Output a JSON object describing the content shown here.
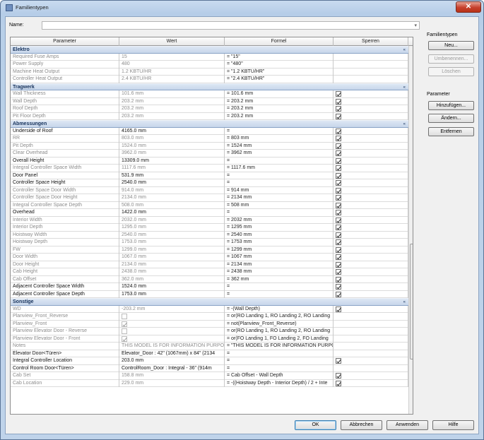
{
  "window": {
    "title": "Familientypen",
    "close_glyph": "✕"
  },
  "name_field": {
    "label": "Name:",
    "value": ""
  },
  "grid": {
    "headers": [
      "Parameter",
      "Wert",
      "Formel",
      "Sperren"
    ],
    "groups": [
      {
        "label": "Elektro",
        "toggle": "«",
        "rows": [
          {
            "p": "Required Fuse Amps",
            "w": "15",
            "f": "= \"15\"",
            "lock": null,
            "style": "gray"
          },
          {
            "p": "Power Supply",
            "w": "480",
            "f": "= \"480\"",
            "lock": null,
            "style": "gray"
          },
          {
            "p": "Machine Heat Output",
            "w": "1.2 KBTU/HR",
            "f": "= \"1.2 KBTU/HR\"",
            "lock": null,
            "style": "gray"
          },
          {
            "p": "Controller Heat Output",
            "w": "2.4 KBTU/HR",
            "f": "= \"2.4 KBTU/HR\"",
            "lock": null,
            "style": "gray"
          }
        ]
      },
      {
        "label": "Tragwerk",
        "toggle": "«",
        "rows": [
          {
            "p": "Wall Thickness",
            "w": "101.6 mm",
            "f": "= 101.6 mm",
            "lock": "on",
            "style": "gray"
          },
          {
            "p": "Wall Depth",
            "w": "203.2 mm",
            "f": "= 203.2 mm",
            "lock": "on",
            "style": "gray"
          },
          {
            "p": "Roof Depth",
            "w": "203.2 mm",
            "f": "= 203.2 mm",
            "lock": "on",
            "style": "gray"
          },
          {
            "p": "Pit Floor Depth",
            "w": "203.2 mm",
            "f": "= 203.2 mm",
            "lock": "on",
            "style": "gray"
          }
        ]
      },
      {
        "label": "Abmessungen",
        "toggle": "«",
        "rows": [
          {
            "p": "Underside of Roof",
            "w": "4165.0 mm",
            "f": "=",
            "lock": "on",
            "style": "dark"
          },
          {
            "p": "RR",
            "w": "803.0 mm",
            "f": "= 803 mm",
            "lock": "on",
            "style": "gray"
          },
          {
            "p": "Pit Depth",
            "w": "1524.0 mm",
            "f": "= 1524 mm",
            "lock": "on",
            "style": "gray"
          },
          {
            "p": "Clear Overhead",
            "w": "3962.0 mm",
            "f": "= 3962 mm",
            "lock": "on",
            "style": "gray"
          },
          {
            "p": "Overall Height",
            "w": "13309.0 mm",
            "f": "=",
            "lock": "on",
            "style": "dark"
          },
          {
            "p": "Integral Controller Space Width",
            "w": "1117.6 mm",
            "f": "= 1117.6 mm",
            "lock": "on",
            "style": "gray"
          },
          {
            "p": "Door Panel",
            "w": "531.9 mm",
            "f": "=",
            "lock": "on",
            "style": "dark"
          },
          {
            "p": "Controller Space Height",
            "w": "2540.0 mm",
            "f": "=",
            "lock": "on",
            "style": "dark"
          },
          {
            "p": "Controller Space Door Width",
            "w": "914.0 mm",
            "f": "= 914 mm",
            "lock": "on",
            "style": "gray"
          },
          {
            "p": "Controller Space Door Height",
            "w": "2134.0 mm",
            "f": "= 2134 mm",
            "lock": "on",
            "style": "gray"
          },
          {
            "p": "Integral Controller Space Depth",
            "w": "508.0 mm",
            "f": "= 508 mm",
            "lock": "on",
            "style": "gray"
          },
          {
            "p": "Overhead",
            "w": "1422.0 mm",
            "f": "=",
            "lock": "on",
            "style": "dark"
          },
          {
            "p": "Interior Width",
            "w": "2032.0 mm",
            "f": "= 2032 mm",
            "lock": "on",
            "style": "gray"
          },
          {
            "p": "Interior Depth",
            "w": "1295.0 mm",
            "f": "= 1295 mm",
            "lock": "on",
            "style": "gray"
          },
          {
            "p": "Hoistway Width",
            "w": "2540.0 mm",
            "f": "= 2540 mm",
            "lock": "on",
            "style": "gray"
          },
          {
            "p": "Hoistway Depth",
            "w": "1753.0 mm",
            "f": "= 1753 mm",
            "lock": "on",
            "style": "gray"
          },
          {
            "p": "FW",
            "w": "1299.0 mm",
            "f": "= 1299 mm",
            "lock": "on",
            "style": "gray"
          },
          {
            "p": "Door Width",
            "w": "1067.0 mm",
            "f": "= 1067 mm",
            "lock": "on",
            "style": "gray"
          },
          {
            "p": "Door Height",
            "w": "2134.0 mm",
            "f": "= 2134 mm",
            "lock": "on",
            "style": "gray"
          },
          {
            "p": "Cab Height",
            "w": "2438.0 mm",
            "f": "= 2438 mm",
            "lock": "on",
            "style": "gray"
          },
          {
            "p": "Cab Offset",
            "w": "362.0 mm",
            "f": "= 362 mm",
            "lock": "on",
            "style": "gray"
          },
          {
            "p": "Adjacent Controller Space Width",
            "w": "1524.0 mm",
            "f": "=",
            "lock": "on",
            "style": "dark"
          },
          {
            "p": "Adjacent Controller Space Depth",
            "w": "1753.0 mm",
            "f": "=",
            "lock": "on",
            "style": "dark"
          }
        ]
      },
      {
        "label": "Sonstige",
        "toggle": "«",
        "rows": [
          {
            "p": "WD",
            "w": "-203.2 mm",
            "f": "= -(Wall Depth)",
            "lock": "on",
            "style": "gray"
          },
          {
            "p": "Planview_Front_Reverse",
            "w": "",
            "wchk": "dim",
            "f": "= or(RO Landing 1, RO Landing 2, RO Landing",
            "lock": null,
            "style": "gray"
          },
          {
            "p": "Planview_Front",
            "w": "",
            "wchk": "dim-on",
            "f": "= not(Planview_Front_Reverse)",
            "lock": null,
            "style": "gray"
          },
          {
            "p": "Planview Elevator Door - Reverse",
            "w": "",
            "wchk": "dim",
            "f": "= or(RO Landing 1, RO Landing 2, RO Landing",
            "lock": null,
            "style": "gray"
          },
          {
            "p": "Planview Elevator Door - Front",
            "w": "",
            "wchk": "dim-on",
            "f": "= or(FO Landing 1, FO Landing 2, FO Landing",
            "lock": null,
            "style": "gray"
          },
          {
            "p": "Notes",
            "w": "THIS MODEL IS FOR INFORMATION PURPOS",
            "f": "= \"THIS MODEL IS FOR INFORMATION PURPO",
            "lock": null,
            "style": "gray"
          },
          {
            "p": "Elevator Door<Türen>",
            "w": "Elevator_Door : 42\" (1067mm) x 84\" (2134",
            "f": "=",
            "lock": null,
            "style": "dark"
          },
          {
            "p": "Integral Controller Location",
            "w": "203.0 mm",
            "f": "=",
            "lock": "on",
            "style": "dark"
          },
          {
            "p": "Control Room Door<Türen>",
            "w": "ControlRoom_Door : Integral - 36\" (914m",
            "f": "=",
            "lock": null,
            "style": "dark"
          },
          {
            "p": "Cab Set",
            "w": "158.8 mm",
            "f": "= Cab Offset - Wall Depth",
            "lock": "on",
            "style": "gray"
          },
          {
            "p": "Cab Location",
            "w": "229.0 mm",
            "f": "= -((Hoistway Depth - Interior Depth) / 2 + Inte",
            "lock": "on",
            "style": "gray"
          }
        ]
      }
    ]
  },
  "sidebar": {
    "family_types_label": "Familientypen",
    "new_button": "Neu...",
    "rename_button": "Umbenennen...",
    "delete_button": "Löschen",
    "parameter_label": "Parameter",
    "add_button": "Hinzufügen...",
    "modify_button": "Ändern...",
    "remove_button": "Entfernen"
  },
  "footer": {
    "ok": "OK",
    "cancel": "Abbrechen",
    "apply": "Anwenden",
    "help": "Hilfe"
  }
}
